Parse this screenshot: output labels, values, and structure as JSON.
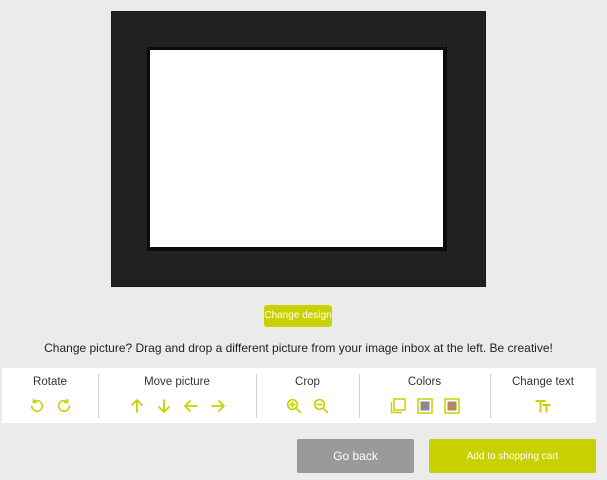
{
  "accent_color": "#c8d200",
  "preview": {
    "card_color": "#1f1f1f",
    "photo_area_color": "#ffffff"
  },
  "change_design_label": "Change design",
  "hint_text": "Change picture? Drag and drop a different picture from your image inbox at the left. Be creative!",
  "toolbar": {
    "rotate": {
      "title": "Rotate",
      "icons": [
        "rotate-left-icon",
        "rotate-right-icon"
      ]
    },
    "move": {
      "title": "Move picture",
      "icons": [
        "arrow-up-icon",
        "arrow-down-icon",
        "arrow-left-icon",
        "arrow-right-icon"
      ]
    },
    "crop": {
      "title": "Crop",
      "icons": [
        "zoom-in-icon",
        "zoom-out-icon"
      ]
    },
    "colors": {
      "title": "Colors",
      "icons": [
        "frame-white-icon",
        "frame-dark-icon",
        "frame-color-icon"
      ]
    },
    "text": {
      "title": "Change text",
      "icons": [
        "text-size-icon"
      ]
    }
  },
  "actions": {
    "back_label": "Go back",
    "cart_label": "Add to shopping cart"
  }
}
